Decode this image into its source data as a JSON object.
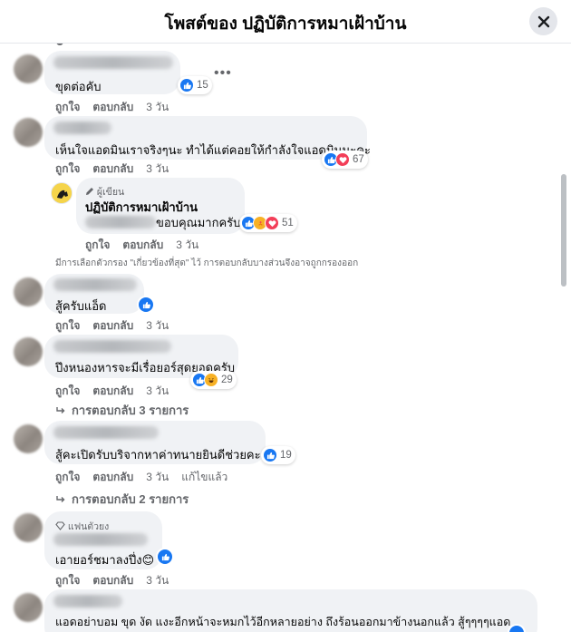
{
  "header": {
    "title": "โพสต์ของ ปฏิบัติการหมาเฝ้าบ้าน"
  },
  "labels": {
    "like": "ถูกใจ",
    "reply": "ตอบกลับ",
    "edited": "แก้ไขแล้ว",
    "author_badge": "ผู้เขียน",
    "fan_badge": "แฟนตัวยง"
  },
  "comments": [
    {
      "text": "ขุดต่อคับ",
      "time": "3 วัน",
      "reactions": "15"
    },
    {
      "text": "เห็นใจแอดมินเราจริงๆนะ ทำได้แต่คอยให้กำลังใจแอดมินนะคะ",
      "time": "3 วัน",
      "reactions": "67"
    },
    {
      "author": "ปฏิบัติการหมาเฝ้าบ้าน",
      "text": "ขอบคุณมากครับ",
      "time": "3 วัน",
      "reactions": "51"
    },
    {
      "text": "สู้ครับแอ็ด",
      "time": "3 วัน"
    },
    {
      "text": "ปึงหนองหารจะมีเรื่อยอร์สุดยอดครับ",
      "time": "3 วัน",
      "reactions": "29",
      "more": "การตอบกลับ 3 รายการ"
    },
    {
      "text": "สู้คะเปิดรับบริจากหาค่าทนายยินดีช่วยคะ",
      "time": "3 วัน",
      "reactions": "19",
      "more": "การตอบกลับ 2 รายการ"
    },
    {
      "text": "เอายอร์ชมาลงปึ่ง😊",
      "time": "3 วัน"
    },
    {
      "text": "แอดอย่าบอม ขุด งัด แงะอีกหน้าจะหมกไว้อีกหลายอย่าง ถึงร้อนออกมาข้างนอกแล้ว สู้ๆๆๆๆแอด"
    }
  ],
  "filter_note": "มีการเลือกตัวกรอง \"เกี่ยวข้องที่สุด\" ไว้ การตอบกลับบางส่วนจึงอาจถูกกรองออก",
  "colors": {
    "like_blue": "#1877f2",
    "love_red": "#f33e58",
    "bubble": "#f0f2f5",
    "meta_gray": "#65676b"
  }
}
